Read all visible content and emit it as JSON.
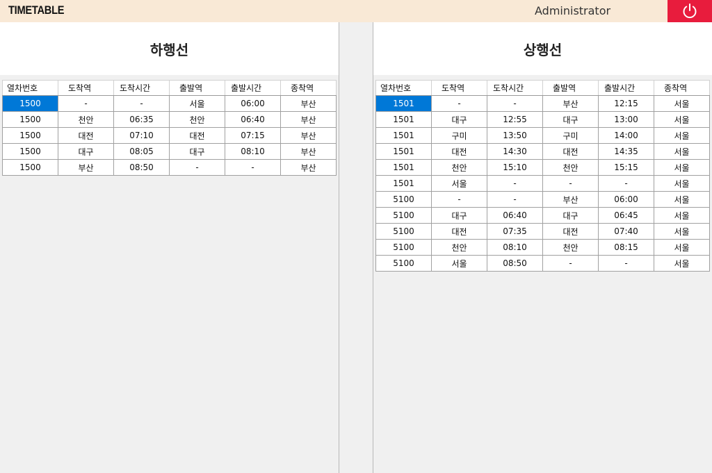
{
  "app": {
    "title": "TIMETABLE",
    "user": "Administrator",
    "power_icon": "power-icon",
    "accent": "#e81c3d"
  },
  "columns": [
    "열차번호",
    "도착역",
    "도착시간",
    "출발역",
    "출발시간",
    "종착역"
  ],
  "down_line": {
    "title": "하행선",
    "rows": [
      [
        "1500",
        "-",
        "-",
        "서울",
        "06:00",
        "부산"
      ],
      [
        "1500",
        "천안",
        "06:35",
        "천안",
        "06:40",
        "부산"
      ],
      [
        "1500",
        "대전",
        "07:10",
        "대전",
        "07:15",
        "부산"
      ],
      [
        "1500",
        "대구",
        "08:05",
        "대구",
        "08:10",
        "부산"
      ],
      [
        "1500",
        "부산",
        "08:50",
        "-",
        "-",
        "부산"
      ]
    ]
  },
  "up_line": {
    "title": "상행선",
    "rows": [
      [
        "1501",
        "-",
        "-",
        "부산",
        "12:15",
        "서울"
      ],
      [
        "1501",
        "대구",
        "12:55",
        "대구",
        "13:00",
        "서울"
      ],
      [
        "1501",
        "구미",
        "13:50",
        "구미",
        "14:00",
        "서울"
      ],
      [
        "1501",
        "대전",
        "14:30",
        "대전",
        "14:35",
        "서울"
      ],
      [
        "1501",
        "천안",
        "15:10",
        "천안",
        "15:15",
        "서울"
      ],
      [
        "1501",
        "서울",
        "-",
        "-",
        "-",
        "서울"
      ],
      [
        "5100",
        "-",
        "-",
        "부산",
        "06:00",
        "서울"
      ],
      [
        "5100",
        "대구",
        "06:40",
        "대구",
        "06:45",
        "서울"
      ],
      [
        "5100",
        "대전",
        "07:35",
        "대전",
        "07:40",
        "서울"
      ],
      [
        "5100",
        "천안",
        "08:10",
        "천안",
        "08:15",
        "서울"
      ],
      [
        "5100",
        "서울",
        "08:50",
        "-",
        "-",
        "서울"
      ]
    ]
  }
}
